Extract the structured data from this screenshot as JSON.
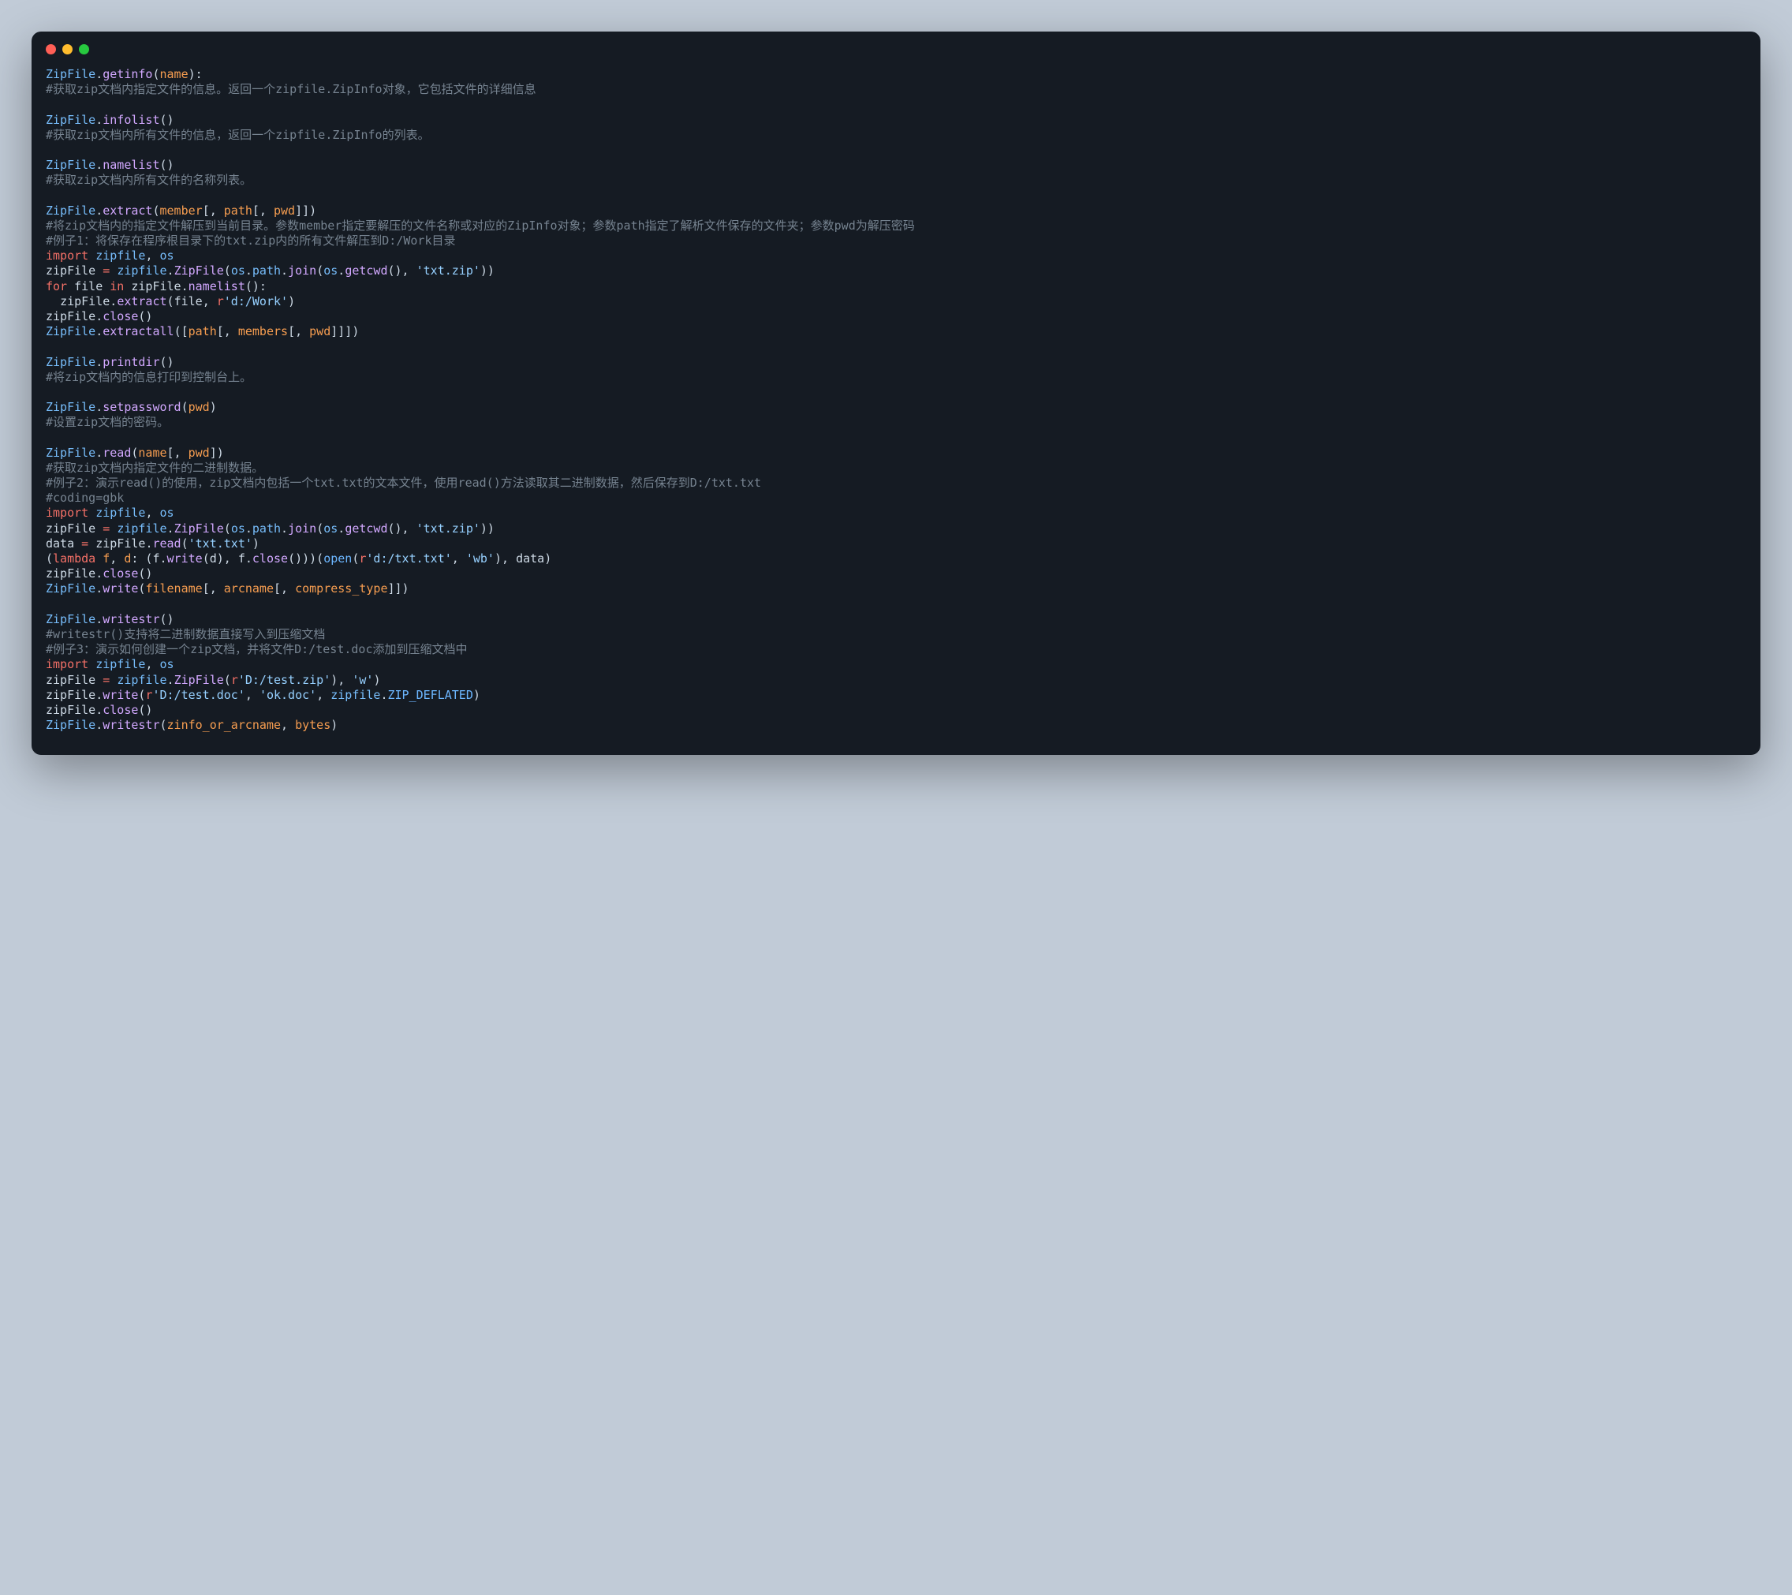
{
  "window": {
    "traffic_lights": [
      "close",
      "minimize",
      "maximize"
    ]
  },
  "code": {
    "lines": [
      [
        [
          "c-class",
          "ZipFile"
        ],
        [
          "c-punct",
          "."
        ],
        [
          "c-method",
          "getinfo"
        ],
        [
          "c-punct",
          "("
        ],
        [
          "c-param",
          "name"
        ],
        [
          "c-punct",
          "):"
        ]
      ],
      [
        [
          "c-comment",
          "#获取zip文档内指定文件的信息。返回一个zipfile.ZipInfo对象，它包括文件的详细信息"
        ]
      ],
      [],
      [
        [
          "c-class",
          "ZipFile"
        ],
        [
          "c-punct",
          "."
        ],
        [
          "c-method",
          "infolist"
        ],
        [
          "c-punct",
          "()"
        ]
      ],
      [
        [
          "c-comment",
          "#获取zip文档内所有文件的信息，返回一个zipfile.ZipInfo的列表。"
        ]
      ],
      [],
      [
        [
          "c-class",
          "ZipFile"
        ],
        [
          "c-punct",
          "."
        ],
        [
          "c-method",
          "namelist"
        ],
        [
          "c-punct",
          "()"
        ]
      ],
      [
        [
          "c-comment",
          "#获取zip文档内所有文件的名称列表。"
        ]
      ],
      [],
      [
        [
          "c-class",
          "ZipFile"
        ],
        [
          "c-punct",
          "."
        ],
        [
          "c-method",
          "extract"
        ],
        [
          "c-punct",
          "("
        ],
        [
          "c-param",
          "member"
        ],
        [
          "c-punct",
          "[, "
        ],
        [
          "c-param",
          "path"
        ],
        [
          "c-punct",
          "[, "
        ],
        [
          "c-param",
          "pwd"
        ],
        [
          "c-punct",
          "]])"
        ]
      ],
      [
        [
          "c-comment",
          "#将zip文档内的指定文件解压到当前目录。参数member指定要解压的文件名称或对应的ZipInfo对象；参数path指定了解析文件保存的文件夹；参数pwd为解压密码"
        ]
      ],
      [
        [
          "c-comment",
          "#例子1：将保存在程序根目录下的txt.zip内的所有文件解压到D:/Work目录"
        ]
      ],
      [
        [
          "c-kw",
          "import"
        ],
        [
          "c-punct",
          " "
        ],
        [
          "c-class",
          "zipfile"
        ],
        [
          "c-punct",
          ", "
        ],
        [
          "c-class",
          "os"
        ]
      ],
      [
        [
          "c-var",
          "zipFile"
        ],
        [
          "c-punct",
          " "
        ],
        [
          "c-kw",
          "="
        ],
        [
          "c-punct",
          " "
        ],
        [
          "c-class",
          "zipfile"
        ],
        [
          "c-punct",
          "."
        ],
        [
          "c-method",
          "ZipFile"
        ],
        [
          "c-punct",
          "("
        ],
        [
          "c-class",
          "os"
        ],
        [
          "c-punct",
          "."
        ],
        [
          "c-class",
          "path"
        ],
        [
          "c-punct",
          "."
        ],
        [
          "c-method",
          "join"
        ],
        [
          "c-punct",
          "("
        ],
        [
          "c-class",
          "os"
        ],
        [
          "c-punct",
          "."
        ],
        [
          "c-method",
          "getcwd"
        ],
        [
          "c-punct",
          "(), "
        ],
        [
          "c-str",
          "'txt.zip'"
        ],
        [
          "c-punct",
          "))"
        ]
      ],
      [
        [
          "c-kw",
          "for"
        ],
        [
          "c-punct",
          " "
        ],
        [
          "c-var",
          "file"
        ],
        [
          "c-punct",
          " "
        ],
        [
          "c-kw",
          "in"
        ],
        [
          "c-punct",
          " "
        ],
        [
          "c-var",
          "zipFile"
        ],
        [
          "c-punct",
          "."
        ],
        [
          "c-method",
          "namelist"
        ],
        [
          "c-punct",
          "():"
        ]
      ],
      [
        [
          "c-punct",
          "  "
        ],
        [
          "c-var",
          "zipFile"
        ],
        [
          "c-punct",
          "."
        ],
        [
          "c-method",
          "extract"
        ],
        [
          "c-punct",
          "("
        ],
        [
          "c-var",
          "file"
        ],
        [
          "c-punct",
          ", "
        ],
        [
          "c-kw",
          "r"
        ],
        [
          "c-str",
          "'d:/Work'"
        ],
        [
          "c-punct",
          ")"
        ]
      ],
      [
        [
          "c-var",
          "zipFile"
        ],
        [
          "c-punct",
          "."
        ],
        [
          "c-method",
          "close"
        ],
        [
          "c-punct",
          "()"
        ]
      ],
      [
        [
          "c-class",
          "ZipFile"
        ],
        [
          "c-punct",
          "."
        ],
        [
          "c-method",
          "extractall"
        ],
        [
          "c-punct",
          "(["
        ],
        [
          "c-param",
          "path"
        ],
        [
          "c-punct",
          "[, "
        ],
        [
          "c-param",
          "members"
        ],
        [
          "c-punct",
          "[, "
        ],
        [
          "c-param",
          "pwd"
        ],
        [
          "c-punct",
          "]]])"
        ]
      ],
      [],
      [
        [
          "c-class",
          "ZipFile"
        ],
        [
          "c-punct",
          "."
        ],
        [
          "c-method",
          "printdir"
        ],
        [
          "c-punct",
          "()"
        ]
      ],
      [
        [
          "c-comment",
          "#将zip文档内的信息打印到控制台上。"
        ]
      ],
      [],
      [
        [
          "c-class",
          "ZipFile"
        ],
        [
          "c-punct",
          "."
        ],
        [
          "c-method",
          "setpassword"
        ],
        [
          "c-punct",
          "("
        ],
        [
          "c-param",
          "pwd"
        ],
        [
          "c-punct",
          ")"
        ]
      ],
      [
        [
          "c-comment",
          "#设置zip文档的密码。"
        ]
      ],
      [],
      [
        [
          "c-class",
          "ZipFile"
        ],
        [
          "c-punct",
          "."
        ],
        [
          "c-method",
          "read"
        ],
        [
          "c-punct",
          "("
        ],
        [
          "c-param",
          "name"
        ],
        [
          "c-punct",
          "[, "
        ],
        [
          "c-param",
          "pwd"
        ],
        [
          "c-punct",
          "])"
        ]
      ],
      [
        [
          "c-comment",
          "#获取zip文档内指定文件的二进制数据。"
        ]
      ],
      [
        [
          "c-comment",
          "#例子2：演示read()的使用，zip文档内包括一个txt.txt的文本文件，使用read()方法读取其二进制数据，然后保存到D:/txt.txt"
        ]
      ],
      [
        [
          "c-comment",
          "#coding=gbk"
        ]
      ],
      [
        [
          "c-kw",
          "import"
        ],
        [
          "c-punct",
          " "
        ],
        [
          "c-class",
          "zipfile"
        ],
        [
          "c-punct",
          ", "
        ],
        [
          "c-class",
          "os"
        ]
      ],
      [
        [
          "c-var",
          "zipFile"
        ],
        [
          "c-punct",
          " "
        ],
        [
          "c-kw",
          "="
        ],
        [
          "c-punct",
          " "
        ],
        [
          "c-class",
          "zipfile"
        ],
        [
          "c-punct",
          "."
        ],
        [
          "c-method",
          "ZipFile"
        ],
        [
          "c-punct",
          "("
        ],
        [
          "c-class",
          "os"
        ],
        [
          "c-punct",
          "."
        ],
        [
          "c-class",
          "path"
        ],
        [
          "c-punct",
          "."
        ],
        [
          "c-method",
          "join"
        ],
        [
          "c-punct",
          "("
        ],
        [
          "c-class",
          "os"
        ],
        [
          "c-punct",
          "."
        ],
        [
          "c-method",
          "getcwd"
        ],
        [
          "c-punct",
          "(), "
        ],
        [
          "c-str",
          "'txt.zip'"
        ],
        [
          "c-punct",
          "))"
        ]
      ],
      [
        [
          "c-var",
          "data"
        ],
        [
          "c-punct",
          " "
        ],
        [
          "c-kw",
          "="
        ],
        [
          "c-punct",
          " "
        ],
        [
          "c-var",
          "zipFile"
        ],
        [
          "c-punct",
          "."
        ],
        [
          "c-method",
          "read"
        ],
        [
          "c-punct",
          "("
        ],
        [
          "c-str",
          "'txt.txt'"
        ],
        [
          "c-punct",
          ")"
        ]
      ],
      [
        [
          "c-punct",
          "("
        ],
        [
          "c-kw",
          "lambda"
        ],
        [
          "c-punct",
          " "
        ],
        [
          "c-param",
          "f"
        ],
        [
          "c-punct",
          ", "
        ],
        [
          "c-param",
          "d"
        ],
        [
          "c-punct",
          ": ("
        ],
        [
          "c-var",
          "f"
        ],
        [
          "c-punct",
          "."
        ],
        [
          "c-method",
          "write"
        ],
        [
          "c-punct",
          "("
        ],
        [
          "c-var",
          "d"
        ],
        [
          "c-punct",
          "), "
        ],
        [
          "c-var",
          "f"
        ],
        [
          "c-punct",
          "."
        ],
        [
          "c-method",
          "close"
        ],
        [
          "c-punct",
          "()))("
        ],
        [
          "c-builtin",
          "open"
        ],
        [
          "c-punct",
          "("
        ],
        [
          "c-kw",
          "r"
        ],
        [
          "c-str",
          "'d:/txt.txt'"
        ],
        [
          "c-punct",
          ", "
        ],
        [
          "c-str",
          "'wb'"
        ],
        [
          "c-punct",
          "), "
        ],
        [
          "c-var",
          "data"
        ],
        [
          "c-punct",
          ")"
        ]
      ],
      [
        [
          "c-var",
          "zipFile"
        ],
        [
          "c-punct",
          "."
        ],
        [
          "c-method",
          "close"
        ],
        [
          "c-punct",
          "()"
        ]
      ],
      [
        [
          "c-class",
          "ZipFile"
        ],
        [
          "c-punct",
          "."
        ],
        [
          "c-method",
          "write"
        ],
        [
          "c-punct",
          "("
        ],
        [
          "c-param",
          "filename"
        ],
        [
          "c-punct",
          "[, "
        ],
        [
          "c-param",
          "arcname"
        ],
        [
          "c-punct",
          "[, "
        ],
        [
          "c-param",
          "compress_type"
        ],
        [
          "c-punct",
          "]])"
        ]
      ],
      [],
      [
        [
          "c-class",
          "ZipFile"
        ],
        [
          "c-punct",
          "."
        ],
        [
          "c-method",
          "writestr"
        ],
        [
          "c-punct",
          "()"
        ]
      ],
      [
        [
          "c-comment",
          "#writestr()支持将二进制数据直接写入到压缩文档"
        ]
      ],
      [
        [
          "c-comment",
          "#例子3：演示如何创建一个zip文档，并将文件D:/test.doc添加到压缩文档中"
        ]
      ],
      [
        [
          "c-kw",
          "import"
        ],
        [
          "c-punct",
          " "
        ],
        [
          "c-class",
          "zipfile"
        ],
        [
          "c-punct",
          ", "
        ],
        [
          "c-class",
          "os"
        ]
      ],
      [
        [
          "c-var",
          "zipFile"
        ],
        [
          "c-punct",
          " "
        ],
        [
          "c-kw",
          "="
        ],
        [
          "c-punct",
          " "
        ],
        [
          "c-class",
          "zipfile"
        ],
        [
          "c-punct",
          "."
        ],
        [
          "c-method",
          "ZipFile"
        ],
        [
          "c-punct",
          "("
        ],
        [
          "c-kw",
          "r"
        ],
        [
          "c-str",
          "'D:/test.zip'"
        ],
        [
          "c-punct",
          "), "
        ],
        [
          "c-str",
          "'w'"
        ],
        [
          "c-punct",
          ")"
        ]
      ],
      [
        [
          "c-var",
          "zipFile"
        ],
        [
          "c-punct",
          "."
        ],
        [
          "c-method",
          "write"
        ],
        [
          "c-punct",
          "("
        ],
        [
          "c-kw",
          "r"
        ],
        [
          "c-str",
          "'D:/test.doc'"
        ],
        [
          "c-punct",
          ", "
        ],
        [
          "c-str",
          "'ok.doc'"
        ],
        [
          "c-punct",
          ", "
        ],
        [
          "c-class",
          "zipfile"
        ],
        [
          "c-punct",
          "."
        ],
        [
          "c-const",
          "ZIP_DEFLATED"
        ],
        [
          "c-punct",
          ")"
        ]
      ],
      [
        [
          "c-var",
          "zipFile"
        ],
        [
          "c-punct",
          "."
        ],
        [
          "c-method",
          "close"
        ],
        [
          "c-punct",
          "()"
        ]
      ],
      [
        [
          "c-class",
          "ZipFile"
        ],
        [
          "c-punct",
          "."
        ],
        [
          "c-method",
          "writestr"
        ],
        [
          "c-punct",
          "("
        ],
        [
          "c-param",
          "zinfo_or_arcname"
        ],
        [
          "c-punct",
          ", "
        ],
        [
          "c-param",
          "bytes"
        ],
        [
          "c-punct",
          ")"
        ]
      ]
    ]
  }
}
